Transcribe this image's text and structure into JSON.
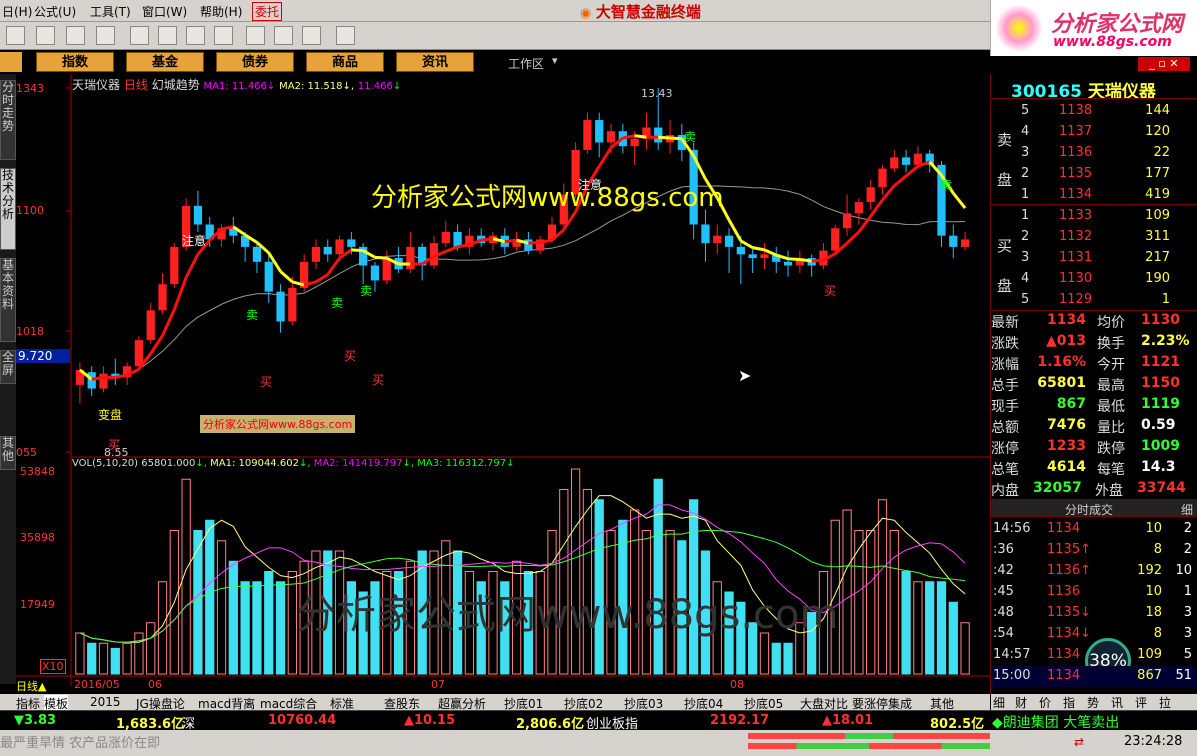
{
  "menu": {
    "items": [
      "日(H)",
      "公式(U)",
      "工具(T)",
      "窗口(W)",
      "帮助(H)"
    ],
    "entrust": "委托",
    "title": "大智慧金融终端"
  },
  "logo": {
    "name": "分析家公式网",
    "url": "www.88gs.com"
  },
  "nav": {
    "buttons": [
      "指数",
      "基金",
      "债券",
      "商品",
      "资讯"
    ],
    "workspace": "工作区"
  },
  "sidetabs": [
    "分时走势",
    "技术分析",
    "基本资料",
    "全屏",
    "其他"
  ],
  "chart": {
    "title": "天瑞仪器",
    "period": "日线",
    "indicator": "幻城趋势",
    "ma1_label": "MA1: 11.466",
    "ma2_label": "MA2: 11.518",
    "ma3_label": "11.466",
    "y_ticks": [
      "1343",
      "1100",
      "1018",
      "055"
    ],
    "current_price": "9.720",
    "high_mark": "13.43",
    "low_mark": "8.55",
    "watermark_main": "分析家公式网www.88gs.com",
    "watermark_box": "分析家公式网www.88gs.com",
    "watermark_vol": "分析家公式网www.88gs.com",
    "signals": {
      "buy": "买",
      "sell": "卖",
      "note": "注意",
      "change": "变盘"
    },
    "vol_title": "VOL(5,10,20)",
    "vol_val": "65801.000",
    "vol_ma1": "MA1: 109044.602",
    "vol_ma2": "MA2: 141419.797",
    "vol_ma3": "MA3: 116312.797",
    "vol_ticks": [
      "53848",
      "35898",
      "17949",
      "X10"
    ],
    "x_labels": [
      "2016/05",
      "06",
      "07",
      "08"
    ]
  },
  "chart_data": {
    "type": "bar",
    "candles": [
      [
        9.45,
        9.65,
        9.75,
        9.2
      ],
      [
        9.62,
        9.4,
        9.7,
        9.3
      ],
      [
        9.4,
        9.6,
        9.7,
        9.35
      ],
      [
        9.6,
        9.55,
        9.8,
        9.45
      ],
      [
        9.55,
        9.7,
        9.75,
        9.45
      ],
      [
        9.7,
        10.05,
        10.1,
        9.68
      ],
      [
        10.05,
        10.45,
        10.55,
        10.0
      ],
      [
        10.45,
        10.8,
        10.95,
        10.4
      ],
      [
        10.8,
        11.3,
        11.35,
        10.75
      ],
      [
        11.3,
        11.85,
        11.95,
        11.25
      ],
      [
        11.85,
        11.6,
        12.05,
        11.5
      ],
      [
        11.6,
        11.4,
        11.7,
        11.3
      ],
      [
        11.4,
        11.55,
        11.6,
        11.3
      ],
      [
        11.55,
        11.45,
        11.7,
        11.35
      ],
      [
        11.45,
        11.3,
        11.5,
        11.1
      ],
      [
        11.3,
        11.1,
        11.35,
        10.95
      ],
      [
        11.1,
        10.7,
        11.2,
        10.55
      ],
      [
        10.7,
        10.3,
        10.8,
        10.15
      ],
      [
        10.3,
        10.75,
        10.9,
        10.25
      ],
      [
        10.75,
        11.1,
        11.2,
        10.7
      ],
      [
        11.1,
        11.3,
        11.4,
        11.0
      ],
      [
        11.3,
        11.2,
        11.4,
        11.1
      ],
      [
        11.2,
        11.4,
        11.45,
        11.1
      ],
      [
        11.4,
        11.3,
        11.5,
        11.2
      ],
      [
        11.3,
        11.05,
        11.35,
        10.8
      ],
      [
        11.05,
        10.85,
        11.1,
        10.7
      ],
      [
        10.85,
        11.15,
        11.25,
        10.8
      ],
      [
        11.15,
        11.0,
        11.3,
        10.95
      ],
      [
        11.0,
        11.3,
        11.5,
        10.95
      ],
      [
        11.3,
        11.05,
        11.35,
        10.85
      ],
      [
        11.05,
        11.35,
        11.45,
        11.0
      ],
      [
        11.35,
        11.5,
        11.65,
        11.3
      ],
      [
        11.5,
        11.3,
        11.6,
        11.25
      ],
      [
        11.3,
        11.45,
        11.55,
        11.2
      ],
      [
        11.45,
        11.35,
        11.55,
        11.3
      ],
      [
        11.35,
        11.45,
        11.5,
        11.25
      ],
      [
        11.45,
        11.3,
        11.55,
        11.2
      ],
      [
        11.3,
        11.4,
        11.5,
        11.25
      ],
      [
        11.4,
        11.25,
        11.5,
        11.2
      ],
      [
        11.25,
        11.4,
        11.45,
        11.2
      ],
      [
        11.4,
        11.6,
        11.7,
        11.35
      ],
      [
        11.6,
        12.0,
        12.15,
        11.55
      ],
      [
        12.0,
        12.6,
        12.7,
        11.95
      ],
      [
        12.6,
        13.0,
        13.1,
        12.55
      ],
      [
        13.0,
        12.7,
        13.1,
        12.5
      ],
      [
        12.7,
        12.85,
        12.95,
        12.55
      ],
      [
        12.85,
        12.65,
        12.95,
        12.55
      ],
      [
        12.65,
        12.75,
        12.85,
        12.4
      ],
      [
        12.75,
        12.9,
        13.1,
        12.6
      ],
      [
        12.9,
        12.7,
        13.43,
        12.6
      ],
      [
        12.7,
        12.8,
        13.0,
        12.55
      ],
      [
        12.8,
        12.6,
        12.95,
        12.45
      ],
      [
        12.6,
        11.6,
        12.7,
        11.4
      ],
      [
        11.6,
        11.35,
        11.8,
        11.1
      ],
      [
        11.35,
        11.45,
        11.6,
        11.2
      ],
      [
        11.45,
        11.3,
        11.55,
        10.95
      ],
      [
        11.3,
        11.2,
        11.45,
        10.8
      ],
      [
        11.2,
        11.15,
        11.3,
        10.95
      ],
      [
        11.15,
        11.2,
        11.35,
        11.0
      ],
      [
        11.2,
        11.1,
        11.3,
        10.95
      ],
      [
        11.1,
        11.05,
        11.25,
        10.9
      ],
      [
        11.05,
        11.15,
        11.25,
        10.95
      ],
      [
        11.15,
        11.05,
        11.2,
        10.9
      ],
      [
        11.05,
        11.25,
        11.35,
        11.0
      ],
      [
        11.25,
        11.55,
        11.6,
        11.2
      ],
      [
        11.55,
        11.75,
        12.0,
        11.45
      ],
      [
        11.75,
        11.9,
        11.95,
        11.6
      ],
      [
        11.9,
        12.1,
        12.2,
        11.8
      ],
      [
        12.1,
        12.35,
        12.4,
        12.0
      ],
      [
        12.35,
        12.5,
        12.6,
        12.3
      ],
      [
        12.5,
        12.4,
        12.6,
        12.3
      ],
      [
        12.4,
        12.55,
        12.65,
        12.35
      ],
      [
        12.55,
        12.4,
        12.6,
        12.3
      ],
      [
        12.4,
        11.45,
        12.45,
        11.3
      ],
      [
        11.45,
        11.3,
        11.6,
        11.15
      ],
      [
        11.3,
        11.4,
        11.5,
        11.25
      ]
    ],
    "volumes": [
      4,
      3,
      3,
      2.5,
      3,
      4,
      5,
      9,
      14,
      19,
      14,
      15,
      13,
      11,
      9,
      9,
      10,
      9,
      10,
      11,
      12,
      12,
      12,
      9,
      8,
      9,
      10,
      10,
      11,
      12,
      12,
      13,
      12,
      10,
      9,
      10,
      9,
      11,
      10,
      10,
      14,
      18,
      20,
      18,
      17,
      14,
      15,
      16,
      14,
      19,
      14,
      13,
      17,
      12,
      9,
      8,
      7,
      5,
      4,
      3,
      3,
      5,
      6,
      10,
      15,
      16,
      14,
      14,
      17,
      14,
      10,
      9,
      9,
      9,
      7,
      5
    ],
    "ylim": [
      8.55,
      13.43
    ]
  },
  "quote": {
    "code": "300165",
    "name": "天瑞仪器",
    "sell_label": "卖盘",
    "buy_label": "买盘",
    "asks": [
      {
        "lv": "5",
        "price": "1138",
        "vol": "144"
      },
      {
        "lv": "4",
        "price": "1137",
        "vol": "120"
      },
      {
        "lv": "3",
        "price": "1136",
        "vol": "22"
      },
      {
        "lv": "2",
        "price": "1135",
        "vol": "177"
      },
      {
        "lv": "1",
        "price": "1134",
        "vol": "419"
      }
    ],
    "bids": [
      {
        "lv": "1",
        "price": "1133",
        "vol": "109"
      },
      {
        "lv": "2",
        "price": "1132",
        "vol": "311"
      },
      {
        "lv": "3",
        "price": "1131",
        "vol": "217"
      },
      {
        "lv": "4",
        "price": "1130",
        "vol": "190"
      },
      {
        "lv": "5",
        "price": "1129",
        "vol": "1"
      }
    ],
    "stats": [
      {
        "k1": "最新",
        "v1": "1134",
        "k2": "均价",
        "v2": "1130"
      },
      {
        "k1": "涨跌",
        "v1": "▲013",
        "k2": "换手",
        "v2": "2.23%"
      },
      {
        "k1": "涨幅",
        "v1": "1.16%",
        "k2": "今开",
        "v2": "1121"
      },
      {
        "k1": "总手",
        "v1": "65801",
        "k2": "最高",
        "v2": "1150"
      },
      {
        "k1": "现手",
        "v1": "867",
        "k2": "最低",
        "v2": "1119"
      },
      {
        "k1": "总额",
        "v1": "7476",
        "k2": "量比",
        "v2": "0.59"
      },
      {
        "k1": "涨停",
        "v1": "1233",
        "k2": "跌停",
        "v2": "1009"
      },
      {
        "k1": "总笔",
        "v1": "4614",
        "k2": "每笔",
        "v2": "14.3"
      }
    ],
    "inner_label": "内盘",
    "inner": "32057",
    "outer_label": "外盘",
    "outer": "33744",
    "ticks_title": "分时成交",
    "detail": "细",
    "ticks": [
      {
        "t": "14:56",
        "p": "1134",
        "v": "10",
        "n": "2"
      },
      {
        "t": ":36",
        "p": "1135↑",
        "v": "8",
        "n": "2"
      },
      {
        "t": ":42",
        "p": "1136↑",
        "v": "192",
        "n": "10"
      },
      {
        "t": ":45",
        "p": "1136",
        "v": "10",
        "n": "1"
      },
      {
        "t": ":48",
        "p": "1135↓",
        "v": "18",
        "n": "3"
      },
      {
        "t": ":54",
        "p": "1134↓",
        "v": "8",
        "n": "3"
      },
      {
        "t": "14:57",
        "p": "1134",
        "v": "109",
        "n": "5"
      },
      {
        "t": "15:00",
        "p": "1134",
        "v": "867",
        "n": "51"
      }
    ],
    "gauge": "38%",
    "tabs": [
      "细",
      "财",
      "价",
      "指",
      "势",
      "讯",
      "评",
      "拉"
    ]
  },
  "bottom_tabs": [
    "日线▲",
    "指标",
    "模板",
    "2015",
    "JG操盘论",
    "macd背离",
    "macd综合",
    "标准",
    "查股东",
    "超赢分析",
    "抄底01",
    "抄底02",
    "抄底03",
    "抄底04",
    "抄底05",
    "大盘对比",
    "要涨停集成",
    "其他"
  ],
  "index_bar": {
    "t1": "▼3.83",
    "t2": "1,683.6亿",
    "t3": "深",
    "t4": "10760.44",
    "t5": "▲10.15",
    "t6": "2,806.6亿",
    "t7": "创业板指",
    "t8": "2192.17",
    "t9": "▲18.01",
    "t10": "802.5亿",
    "t11": "◆朗迪集团 大笔卖出"
  },
  "status": {
    "ticker": "最严重旱情 农产品涨价在即",
    "time": "23:24:28"
  }
}
